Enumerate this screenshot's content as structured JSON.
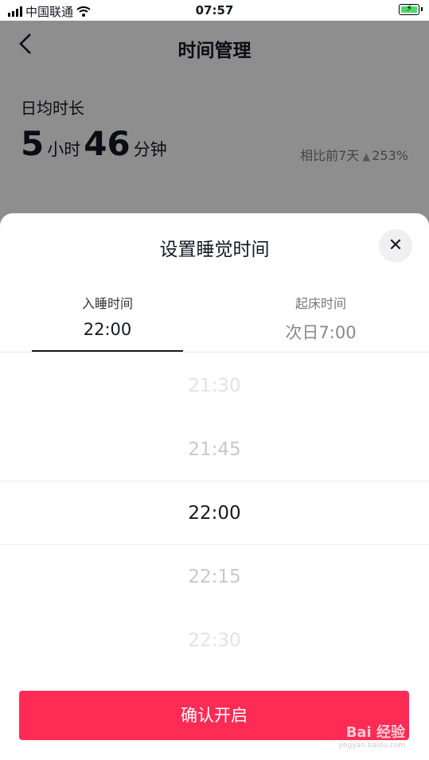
{
  "status_bar": {
    "carrier": "中国联通",
    "time": "07:57"
  },
  "nav": {
    "back_icon": "chevron-left-icon",
    "title": "时间管理"
  },
  "summary": {
    "label": "日均时长",
    "hours": "5",
    "hours_unit": "小时",
    "minutes": "46",
    "minutes_unit": "分钟",
    "compare_label": "相比前7天",
    "compare_value": "253%"
  },
  "sheet": {
    "title": "设置睡觉时间",
    "close_icon": "close-icon",
    "tabs": [
      {
        "label": "入睡时间",
        "value": "22:00",
        "active": true
      },
      {
        "label": "起床时间",
        "value": "次日7:00",
        "active": false
      }
    ],
    "picker": [
      "21:30",
      "21:45",
      "22:00",
      "22:15",
      "22:30"
    ],
    "picker_selected_index": 2,
    "confirm_label": "确认开启"
  },
  "watermark": {
    "text": "Bai 经验",
    "sub": "jingyan.baidu.com"
  },
  "colors": {
    "accent": "#fe2c55",
    "text": "#161823"
  }
}
